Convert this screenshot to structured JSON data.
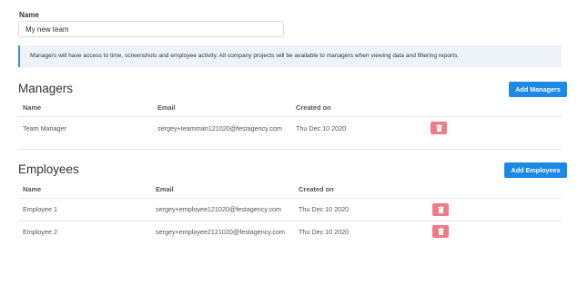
{
  "form": {
    "name_label": "Name",
    "name_value": "My new team"
  },
  "info": {
    "text": "Managers will have access to time, screenshots and employee activity. All company projects will be available to managers when viewing data and filtering reports."
  },
  "managers": {
    "title": "Managers",
    "add_button": "Add Managers",
    "columns": [
      "Name",
      "Email",
      "Created on"
    ],
    "rows": [
      {
        "name": "Team Manager",
        "email": "sergey+teamman121020@festagency.com",
        "created": "Thu Dec 10 2020"
      }
    ]
  },
  "employees": {
    "title": "Employees",
    "add_button": "Add Employees",
    "columns": [
      "Name",
      "Email",
      "Created on"
    ],
    "rows": [
      {
        "name": "Employee 1",
        "email": "sergey+employee121020@festagency.com",
        "created": "Thu Dec 10 2020"
      },
      {
        "name": "Employee 2",
        "email": "sergey+employee2121020@festagency.com",
        "created": "Thu Dec 10 2020"
      }
    ]
  },
  "colors": {
    "primary": "#1e88e5",
    "danger": "#f07a86",
    "info_bg": "#eef3fa",
    "info_border": "#3b8fd9"
  },
  "icons": {
    "delete": "trash-icon"
  }
}
